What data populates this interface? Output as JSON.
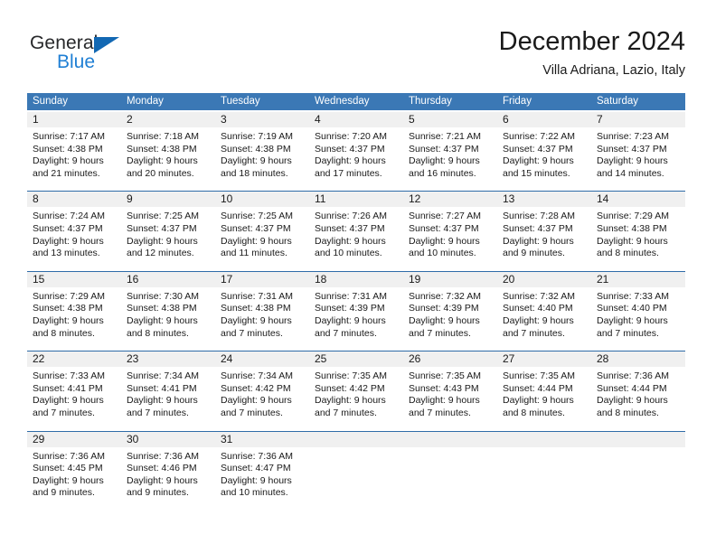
{
  "brand": {
    "name_part1": "General",
    "name_part2": "Blue",
    "triangle_color": "#1268b3",
    "blue_color": "#1f7fd4"
  },
  "header": {
    "title": "December 2024",
    "subtitle": "Villa Adriana, Lazio, Italy"
  },
  "theme": {
    "header_row_bg": "#3b78b5",
    "header_row_text": "#ffffff",
    "day_number_bg": "#f0f0f0",
    "week_separator": "#2f6ca8"
  },
  "weekdays": [
    "Sunday",
    "Monday",
    "Tuesday",
    "Wednesday",
    "Thursday",
    "Friday",
    "Saturday"
  ],
  "weeks": [
    [
      {
        "day": "1",
        "sunrise": "Sunrise: 7:17 AM",
        "sunset": "Sunset: 4:38 PM",
        "daylight1": "Daylight: 9 hours",
        "daylight2": "and 21 minutes."
      },
      {
        "day": "2",
        "sunrise": "Sunrise: 7:18 AM",
        "sunset": "Sunset: 4:38 PM",
        "daylight1": "Daylight: 9 hours",
        "daylight2": "and 20 minutes."
      },
      {
        "day": "3",
        "sunrise": "Sunrise: 7:19 AM",
        "sunset": "Sunset: 4:38 PM",
        "daylight1": "Daylight: 9 hours",
        "daylight2": "and 18 minutes."
      },
      {
        "day": "4",
        "sunrise": "Sunrise: 7:20 AM",
        "sunset": "Sunset: 4:37 PM",
        "daylight1": "Daylight: 9 hours",
        "daylight2": "and 17 minutes."
      },
      {
        "day": "5",
        "sunrise": "Sunrise: 7:21 AM",
        "sunset": "Sunset: 4:37 PM",
        "daylight1": "Daylight: 9 hours",
        "daylight2": "and 16 minutes."
      },
      {
        "day": "6",
        "sunrise": "Sunrise: 7:22 AM",
        "sunset": "Sunset: 4:37 PM",
        "daylight1": "Daylight: 9 hours",
        "daylight2": "and 15 minutes."
      },
      {
        "day": "7",
        "sunrise": "Sunrise: 7:23 AM",
        "sunset": "Sunset: 4:37 PM",
        "daylight1": "Daylight: 9 hours",
        "daylight2": "and 14 minutes."
      }
    ],
    [
      {
        "day": "8",
        "sunrise": "Sunrise: 7:24 AM",
        "sunset": "Sunset: 4:37 PM",
        "daylight1": "Daylight: 9 hours",
        "daylight2": "and 13 minutes."
      },
      {
        "day": "9",
        "sunrise": "Sunrise: 7:25 AM",
        "sunset": "Sunset: 4:37 PM",
        "daylight1": "Daylight: 9 hours",
        "daylight2": "and 12 minutes."
      },
      {
        "day": "10",
        "sunrise": "Sunrise: 7:25 AM",
        "sunset": "Sunset: 4:37 PM",
        "daylight1": "Daylight: 9 hours",
        "daylight2": "and 11 minutes."
      },
      {
        "day": "11",
        "sunrise": "Sunrise: 7:26 AM",
        "sunset": "Sunset: 4:37 PM",
        "daylight1": "Daylight: 9 hours",
        "daylight2": "and 10 minutes."
      },
      {
        "day": "12",
        "sunrise": "Sunrise: 7:27 AM",
        "sunset": "Sunset: 4:37 PM",
        "daylight1": "Daylight: 9 hours",
        "daylight2": "and 10 minutes."
      },
      {
        "day": "13",
        "sunrise": "Sunrise: 7:28 AM",
        "sunset": "Sunset: 4:37 PM",
        "daylight1": "Daylight: 9 hours",
        "daylight2": "and 9 minutes."
      },
      {
        "day": "14",
        "sunrise": "Sunrise: 7:29 AM",
        "sunset": "Sunset: 4:38 PM",
        "daylight1": "Daylight: 9 hours",
        "daylight2": "and 8 minutes."
      }
    ],
    [
      {
        "day": "15",
        "sunrise": "Sunrise: 7:29 AM",
        "sunset": "Sunset: 4:38 PM",
        "daylight1": "Daylight: 9 hours",
        "daylight2": "and 8 minutes."
      },
      {
        "day": "16",
        "sunrise": "Sunrise: 7:30 AM",
        "sunset": "Sunset: 4:38 PM",
        "daylight1": "Daylight: 9 hours",
        "daylight2": "and 8 minutes."
      },
      {
        "day": "17",
        "sunrise": "Sunrise: 7:31 AM",
        "sunset": "Sunset: 4:38 PM",
        "daylight1": "Daylight: 9 hours",
        "daylight2": "and 7 minutes."
      },
      {
        "day": "18",
        "sunrise": "Sunrise: 7:31 AM",
        "sunset": "Sunset: 4:39 PM",
        "daylight1": "Daylight: 9 hours",
        "daylight2": "and 7 minutes."
      },
      {
        "day": "19",
        "sunrise": "Sunrise: 7:32 AM",
        "sunset": "Sunset: 4:39 PM",
        "daylight1": "Daylight: 9 hours",
        "daylight2": "and 7 minutes."
      },
      {
        "day": "20",
        "sunrise": "Sunrise: 7:32 AM",
        "sunset": "Sunset: 4:40 PM",
        "daylight1": "Daylight: 9 hours",
        "daylight2": "and 7 minutes."
      },
      {
        "day": "21",
        "sunrise": "Sunrise: 7:33 AM",
        "sunset": "Sunset: 4:40 PM",
        "daylight1": "Daylight: 9 hours",
        "daylight2": "and 7 minutes."
      }
    ],
    [
      {
        "day": "22",
        "sunrise": "Sunrise: 7:33 AM",
        "sunset": "Sunset: 4:41 PM",
        "daylight1": "Daylight: 9 hours",
        "daylight2": "and 7 minutes."
      },
      {
        "day": "23",
        "sunrise": "Sunrise: 7:34 AM",
        "sunset": "Sunset: 4:41 PM",
        "daylight1": "Daylight: 9 hours",
        "daylight2": "and 7 minutes."
      },
      {
        "day": "24",
        "sunrise": "Sunrise: 7:34 AM",
        "sunset": "Sunset: 4:42 PM",
        "daylight1": "Daylight: 9 hours",
        "daylight2": "and 7 minutes."
      },
      {
        "day": "25",
        "sunrise": "Sunrise: 7:35 AM",
        "sunset": "Sunset: 4:42 PM",
        "daylight1": "Daylight: 9 hours",
        "daylight2": "and 7 minutes."
      },
      {
        "day": "26",
        "sunrise": "Sunrise: 7:35 AM",
        "sunset": "Sunset: 4:43 PM",
        "daylight1": "Daylight: 9 hours",
        "daylight2": "and 7 minutes."
      },
      {
        "day": "27",
        "sunrise": "Sunrise: 7:35 AM",
        "sunset": "Sunset: 4:44 PM",
        "daylight1": "Daylight: 9 hours",
        "daylight2": "and 8 minutes."
      },
      {
        "day": "28",
        "sunrise": "Sunrise: 7:36 AM",
        "sunset": "Sunset: 4:44 PM",
        "daylight1": "Daylight: 9 hours",
        "daylight2": "and 8 minutes."
      }
    ],
    [
      {
        "day": "29",
        "sunrise": "Sunrise: 7:36 AM",
        "sunset": "Sunset: 4:45 PM",
        "daylight1": "Daylight: 9 hours",
        "daylight2": "and 9 minutes."
      },
      {
        "day": "30",
        "sunrise": "Sunrise: 7:36 AM",
        "sunset": "Sunset: 4:46 PM",
        "daylight1": "Daylight: 9 hours",
        "daylight2": "and 9 minutes."
      },
      {
        "day": "31",
        "sunrise": "Sunrise: 7:36 AM",
        "sunset": "Sunset: 4:47 PM",
        "daylight1": "Daylight: 9 hours",
        "daylight2": "and 10 minutes."
      },
      {
        "day": "",
        "sunrise": "",
        "sunset": "",
        "daylight1": "",
        "daylight2": ""
      },
      {
        "day": "",
        "sunrise": "",
        "sunset": "",
        "daylight1": "",
        "daylight2": ""
      },
      {
        "day": "",
        "sunrise": "",
        "sunset": "",
        "daylight1": "",
        "daylight2": ""
      },
      {
        "day": "",
        "sunrise": "",
        "sunset": "",
        "daylight1": "",
        "daylight2": ""
      }
    ]
  ]
}
